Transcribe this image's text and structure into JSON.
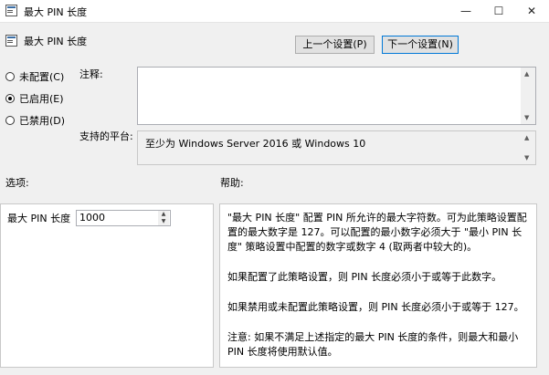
{
  "window": {
    "title": "最大 PIN 长度",
    "controls": {
      "minimize": "—",
      "maximize": "☐",
      "close": "✕"
    }
  },
  "policy": {
    "name": "最大 PIN 长度",
    "prev_button": "上一个设置(P)",
    "next_button": "下一个设置(N)"
  },
  "state": {
    "options": [
      {
        "label": "未配置(C)",
        "selected": false
      },
      {
        "label": "已启用(E)",
        "selected": true
      },
      {
        "label": "已禁用(D)",
        "selected": false
      }
    ]
  },
  "comment": {
    "label": "注释:",
    "value": ""
  },
  "platform": {
    "label": "支持的平台:",
    "value": "至少为 Windows Server 2016 或 Windows 10"
  },
  "options_section": {
    "header": "选项:",
    "field_label": "最大 PIN 长度",
    "field_value": "1000"
  },
  "help_section": {
    "header": "帮助:",
    "paragraphs": [
      "\"最大 PIN 长度\" 配置 PIN 所允许的最大字符数。可为此策略设置配置的最大数字是 127。可以配置的最小数字必须大于 \"最小 PIN 长度\" 策略设置中配置的数字或数字 4 (取两者中较大的)。",
      "如果配置了此策略设置，则 PIN 长度必须小于或等于此数字。",
      "如果禁用或未配置此策略设置，则 PIN 长度必须小于或等于 127。",
      "注意: 如果不满足上述指定的最大 PIN 长度的条件，则最大和最小 PIN 长度将使用默认值。"
    ]
  }
}
